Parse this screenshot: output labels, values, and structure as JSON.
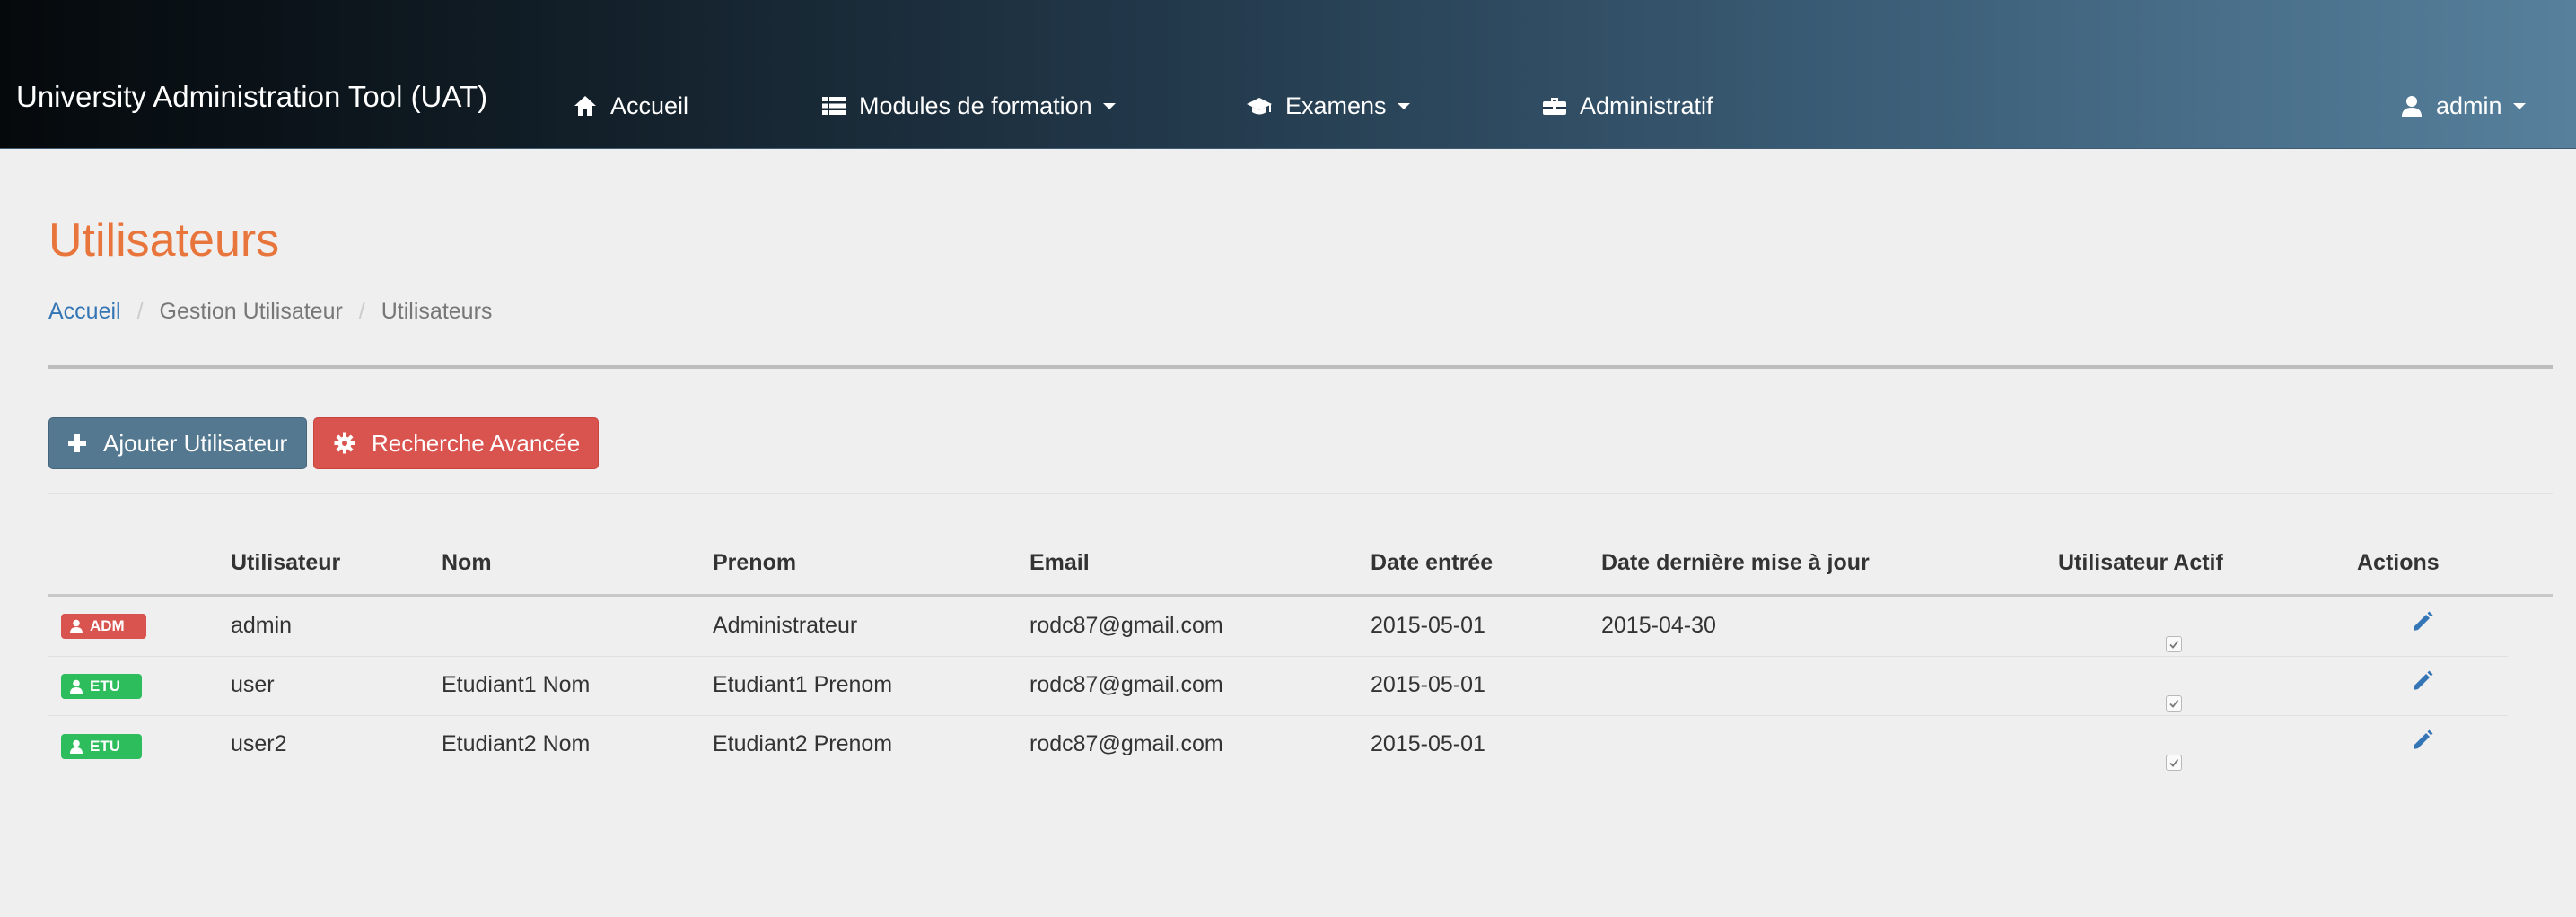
{
  "navbar": {
    "brand": "University Administration Tool (UAT)",
    "items": [
      {
        "label": "Accueil",
        "icon": "home-icon"
      },
      {
        "label": "Modules de formation",
        "icon": "list-icon"
      },
      {
        "label": "Examens",
        "icon": "graduation-cap-icon"
      },
      {
        "label": "Administratif",
        "icon": "briefcase-icon"
      }
    ],
    "user": {
      "label": "admin",
      "icon": "user-icon"
    }
  },
  "page": {
    "title": "Utilisateurs",
    "breadcrumb": [
      "Accueil",
      "Gestion Utilisateur",
      "Utilisateurs"
    ]
  },
  "toolbar": {
    "add_label": "Ajouter Utilisateur",
    "search_label": "Recherche Avancée"
  },
  "table": {
    "headers": [
      "Utilisateur",
      "Nom",
      "Prenom",
      "Email",
      "Date entrée",
      "Date dernière mise à jour",
      "Utilisateur Actif",
      "Actions"
    ],
    "rows": [
      {
        "role": "ADM",
        "utilisateur": "admin",
        "nom": "",
        "prenom": "Administrateur",
        "email": "rodc87@gmail.com",
        "date_entree": "2015-05-01",
        "date_maj": "2015-04-30",
        "actif": true
      },
      {
        "role": "ETU",
        "utilisateur": "user",
        "nom": "Etudiant1 Nom",
        "prenom": "Etudiant1 Prenom",
        "email": "rodc87@gmail.com",
        "date_entree": "2015-05-01",
        "date_maj": "",
        "actif": true
      },
      {
        "role": "ETU",
        "utilisateur": "user2",
        "nom": "Etudiant2 Nom",
        "prenom": "Etudiant2 Prenom",
        "email": "rodc87@gmail.com",
        "date_entree": "2015-05-01",
        "date_maj": "",
        "actif": true
      }
    ]
  },
  "colors": {
    "title": "#e8763c",
    "link": "#3476b5",
    "btn_primary": "#54788f",
    "btn_danger": "#d9534f",
    "badge_adm": "#d9534f",
    "badge_etu": "#2dbd5c"
  }
}
